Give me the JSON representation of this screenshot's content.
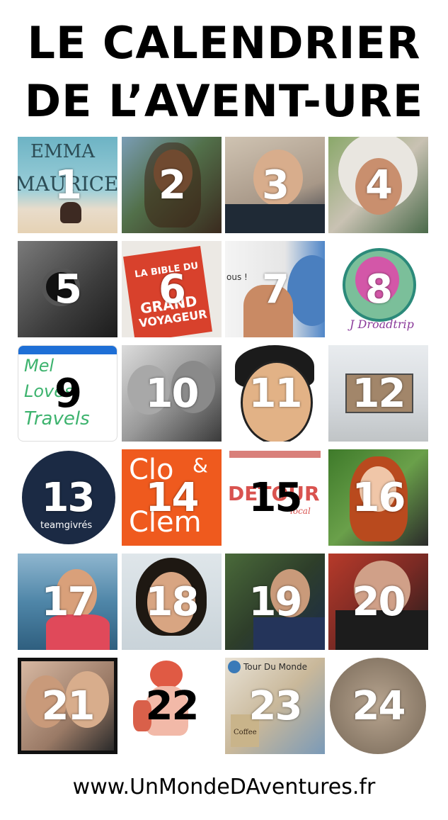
{
  "title": {
    "line1": "LE CALENDRIER",
    "line2": "DE L’AVENT-URE"
  },
  "tiles": [
    {
      "number": "1",
      "overlay_text": [
        "EMMA",
        "MAURICE"
      ]
    },
    {
      "number": "2"
    },
    {
      "number": "3"
    },
    {
      "number": "4"
    },
    {
      "number": "5"
    },
    {
      "number": "6",
      "overlay_text": [
        "LA BIBLE DU",
        "GRAND",
        "VOYAGEUR"
      ]
    },
    {
      "number": "7",
      "overlay_text": [
        "ous !"
      ]
    },
    {
      "number": "8",
      "overlay_text": [
        "J Droadtrip"
      ]
    },
    {
      "number": "9",
      "overlay_text": [
        "Mel",
        "Loves",
        "Travels"
      ]
    },
    {
      "number": "10"
    },
    {
      "number": "11"
    },
    {
      "number": "12"
    },
    {
      "number": "13",
      "overlay_text": [
        "teamgivrés"
      ]
    },
    {
      "number": "14",
      "overlay_text": [
        "Clo",
        "&",
        "Clem"
      ]
    },
    {
      "number": "15",
      "overlay_text": [
        "DETOUR",
        "local"
      ]
    },
    {
      "number": "16"
    },
    {
      "number": "17"
    },
    {
      "number": "18"
    },
    {
      "number": "19"
    },
    {
      "number": "20"
    },
    {
      "number": "21"
    },
    {
      "number": "22"
    },
    {
      "number": "23",
      "overlay_text": [
        "Tour Du Monde",
        "Coffee"
      ]
    },
    {
      "number": "24"
    }
  ],
  "footer": "www.UnMondeDAventures.fr",
  "colors": {
    "background": "#ffffff",
    "title": "#000000",
    "number_light": "#ffffff",
    "number_dark": "#000000",
    "tile_14_bg": "#ef5a1e",
    "tile_9_bar": "#1e6fd6",
    "tile_15_bar": "#d9807a"
  }
}
